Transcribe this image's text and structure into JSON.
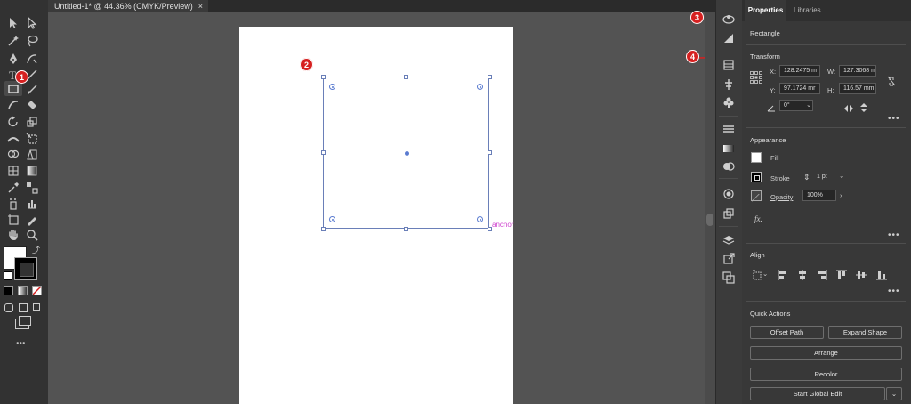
{
  "document_tab": {
    "title": "Untitled-1* @ 44.36% (CMYK/Preview)",
    "close": "×"
  },
  "canvas": {
    "anchor_label": "anchor"
  },
  "callouts": [
    "1",
    "2",
    "3",
    "4"
  ],
  "panel": {
    "tabs": [
      "Properties",
      "Libraries"
    ],
    "object_type": "Rectangle",
    "transform": {
      "title": "Transform",
      "x_label": "X:",
      "x_value": "128.2475 m",
      "w_label": "W:",
      "w_value": "127.3068 m",
      "y_label": "Y:",
      "y_value": "97.1724 mr",
      "h_label": "H:",
      "h_value": "116.57 mm",
      "angle_value": "0°"
    },
    "appearance": {
      "title": "Appearance",
      "fill_label": "Fill",
      "stroke_label": "Stroke",
      "stroke_value": "1 pt",
      "opacity_label": "Opacity",
      "opacity_value": "100%",
      "fx_label": "fx."
    },
    "align": {
      "title": "Align"
    },
    "quick_actions": {
      "title": "Quick Actions",
      "offset_path": "Offset Path",
      "expand_shape": "Expand Shape",
      "arrange": "Arrange",
      "recolor": "Recolor",
      "start_global_edit": "Start Global Edit"
    },
    "more": "•••"
  },
  "colors": {
    "accent_callout": "#d62020",
    "selection": "#6a7fb8",
    "anchor_label": "#d046d0"
  }
}
